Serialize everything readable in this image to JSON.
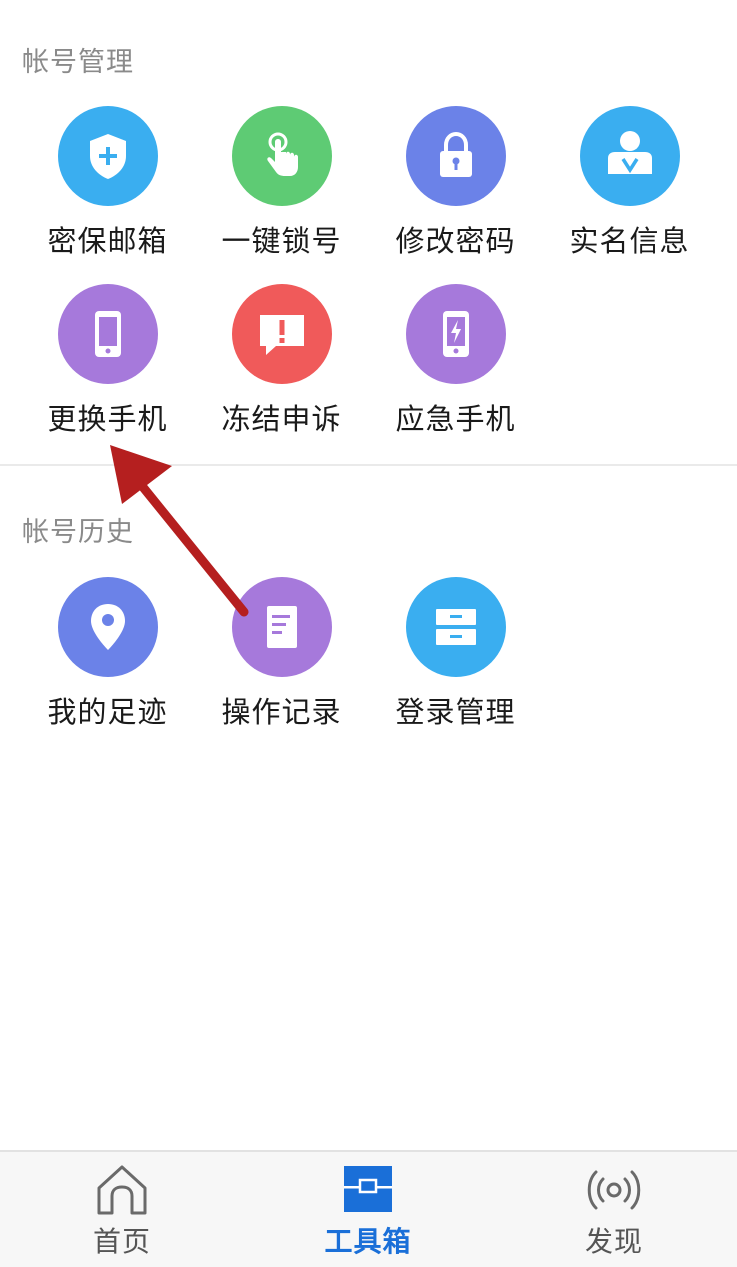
{
  "sections": [
    {
      "title": "帐号管理",
      "items": [
        {
          "label": "密保邮箱",
          "icon": "shield-plus-icon",
          "color": "#3aaef0"
        },
        {
          "label": "一键锁号",
          "icon": "tap-hand-icon",
          "color": "#5ecb74"
        },
        {
          "label": "修改密码",
          "icon": "lock-icon",
          "color": "#6b82e8"
        },
        {
          "label": "实名信息",
          "icon": "id-badge-icon",
          "color": "#3aaef0"
        },
        {
          "label": "更换手机",
          "icon": "phone-icon",
          "color": "#a679db"
        },
        {
          "label": "冻结申诉",
          "icon": "alert-message-icon",
          "color": "#f05a5a"
        },
        {
          "label": "应急手机",
          "icon": "phone-bolt-icon",
          "color": "#a679db"
        }
      ]
    },
    {
      "title": "帐号历史",
      "items": [
        {
          "label": "我的足迹",
          "icon": "location-pin-icon",
          "color": "#6b82e8"
        },
        {
          "label": "操作记录",
          "icon": "document-icon",
          "color": "#a679db"
        },
        {
          "label": "登录管理",
          "icon": "drawer-icon",
          "color": "#3aaef0"
        }
      ]
    }
  ],
  "tabbar": {
    "tabs": [
      {
        "label": "首页",
        "icon": "home-icon",
        "active": false
      },
      {
        "label": "工具箱",
        "icon": "toolbox-icon",
        "active": true
      },
      {
        "label": "发现",
        "icon": "broadcast-icon",
        "active": false
      }
    ]
  },
  "colors": {
    "accent": "#1a6fd8",
    "annotation_arrow": "#b51f1f"
  }
}
